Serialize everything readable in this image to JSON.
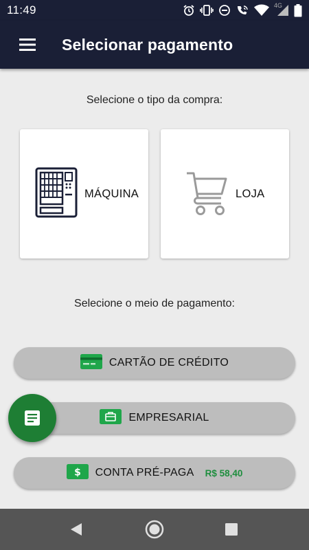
{
  "status_bar": {
    "time": "11:49",
    "network": "4G",
    "icons": [
      "alarm-icon",
      "vibrate-icon",
      "do-not-disturb-icon",
      "wifi-calling-icon",
      "wifi-icon",
      "cellular-signal-icon",
      "battery-icon"
    ]
  },
  "app_bar": {
    "title": "Selecionar pagamento",
    "menu_icon": "hamburger-menu-icon"
  },
  "purchase_type": {
    "prompt": "Selecione o tipo da compra:",
    "options": [
      {
        "label": "MÁQUINA",
        "icon": "vending-machine-icon"
      },
      {
        "label": "LOJA",
        "icon": "shopping-cart-icon"
      }
    ]
  },
  "payment_method": {
    "prompt": "Selecione o meio de pagamento:",
    "options": [
      {
        "label": "CARTÃO DE CRÉDITO",
        "icon": "credit-card-icon"
      },
      {
        "label": "EMPRESARIAL",
        "icon": "briefcase-icon"
      },
      {
        "label": "CONTA PRÉ-PAGA",
        "icon": "dollar-icon",
        "balance": "R$ 58,40"
      }
    ]
  },
  "fab": {
    "icon": "document-icon"
  },
  "nav_bar": {
    "icons": [
      "back-icon",
      "home-icon",
      "recents-icon"
    ]
  },
  "colors": {
    "app_bar": "#1a1f36",
    "accent_green": "#1e7e34",
    "balance_green": "#1e8e3e",
    "button_gray": "#bdbdbd",
    "background": "#ececec"
  }
}
